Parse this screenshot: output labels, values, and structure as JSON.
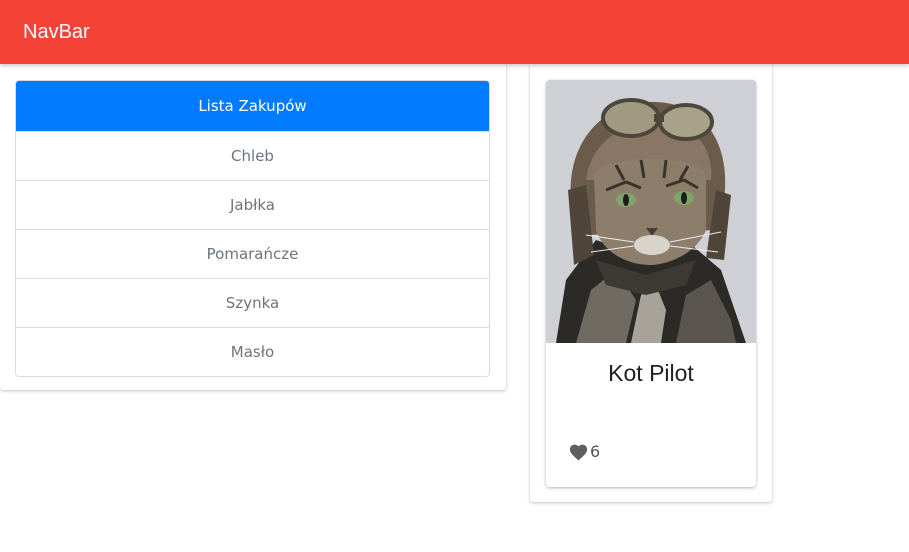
{
  "navbar": {
    "brand": "NavBar",
    "color": "#f44336"
  },
  "shopping_list": {
    "header": "Lista Zakupów",
    "header_color": "#007bff",
    "items": [
      "Chleb",
      "Jabłka",
      "Pomarańcze",
      "Szynka",
      "Masło"
    ]
  },
  "card": {
    "image_alt": "cat-pilot-photo",
    "title": "Kot Pilot",
    "likes": "6",
    "like_icon": "heart-icon"
  }
}
